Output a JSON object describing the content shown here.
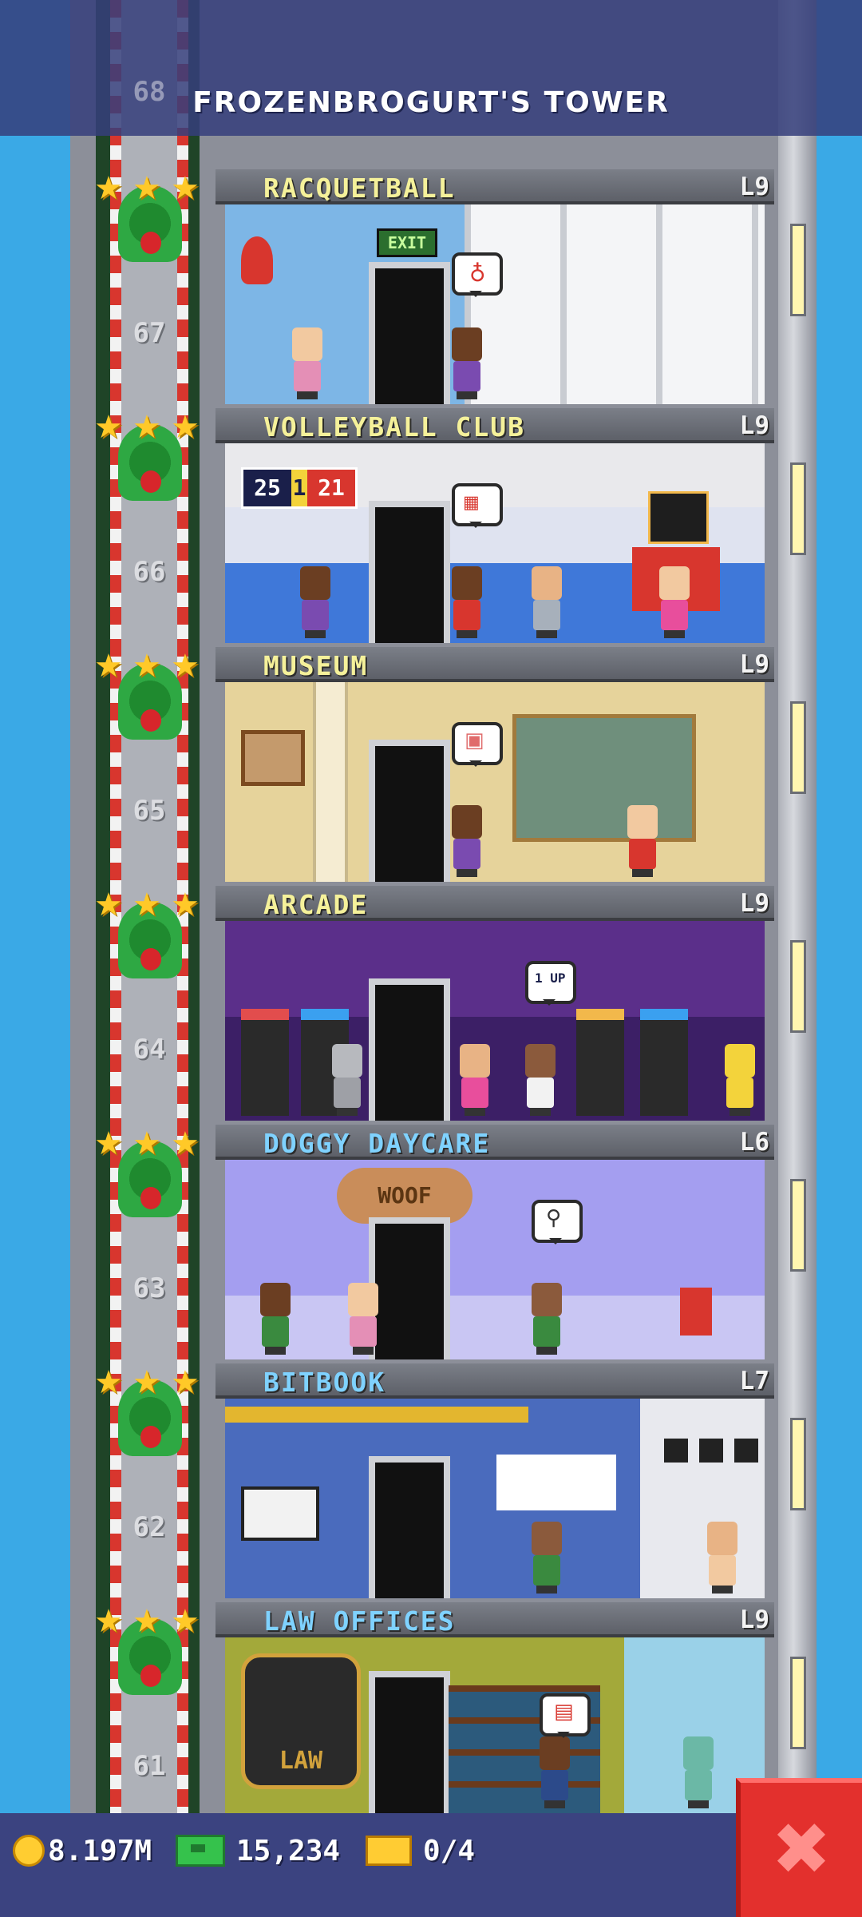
{
  "header": {
    "title": "FROZENBROGURT'S TOWER",
    "top_floor_number": "68"
  },
  "floors": [
    {
      "name": "RACQUETBALL",
      "level": "L9",
      "number": "67",
      "name_color": "yellow"
    },
    {
      "name": "VOLLEYBALL CLUB",
      "level": "L9",
      "number": "66",
      "name_color": "yellow",
      "scoreboard_left": "25",
      "scoreboard_mid": "1",
      "scoreboard_right": "21"
    },
    {
      "name": "MUSEUM",
      "level": "L9",
      "number": "65",
      "name_color": "yellow"
    },
    {
      "name": "ARCADE",
      "level": "L9",
      "number": "64",
      "name_color": "yellow"
    },
    {
      "name": "DOGGY DAYCARE",
      "level": "L6",
      "number": "63",
      "name_color": "blue",
      "sign": "WOOF"
    },
    {
      "name": "BITBOOK",
      "level": "L7",
      "number": "62",
      "name_color": "blue"
    },
    {
      "name": "LAW OFFICES",
      "level": "L9",
      "number": "61",
      "name_color": "blue",
      "sign": "LAW"
    }
  ],
  "racquetball": {
    "exit_sign": "EXIT"
  },
  "arcade": {
    "bubble_text": "1 UP"
  },
  "status_bar": {
    "coins": "8.197M",
    "bux": "15,234",
    "tickets": "0/4"
  },
  "close_button": {
    "icon": "close-icon"
  },
  "colors": {
    "sky": "#3aa9e6",
    "status_bar": "#3b4380",
    "close_button": "#e3302d",
    "floor_name_yellow": "#f5f19a",
    "floor_name_blue": "#7fd2ff"
  }
}
